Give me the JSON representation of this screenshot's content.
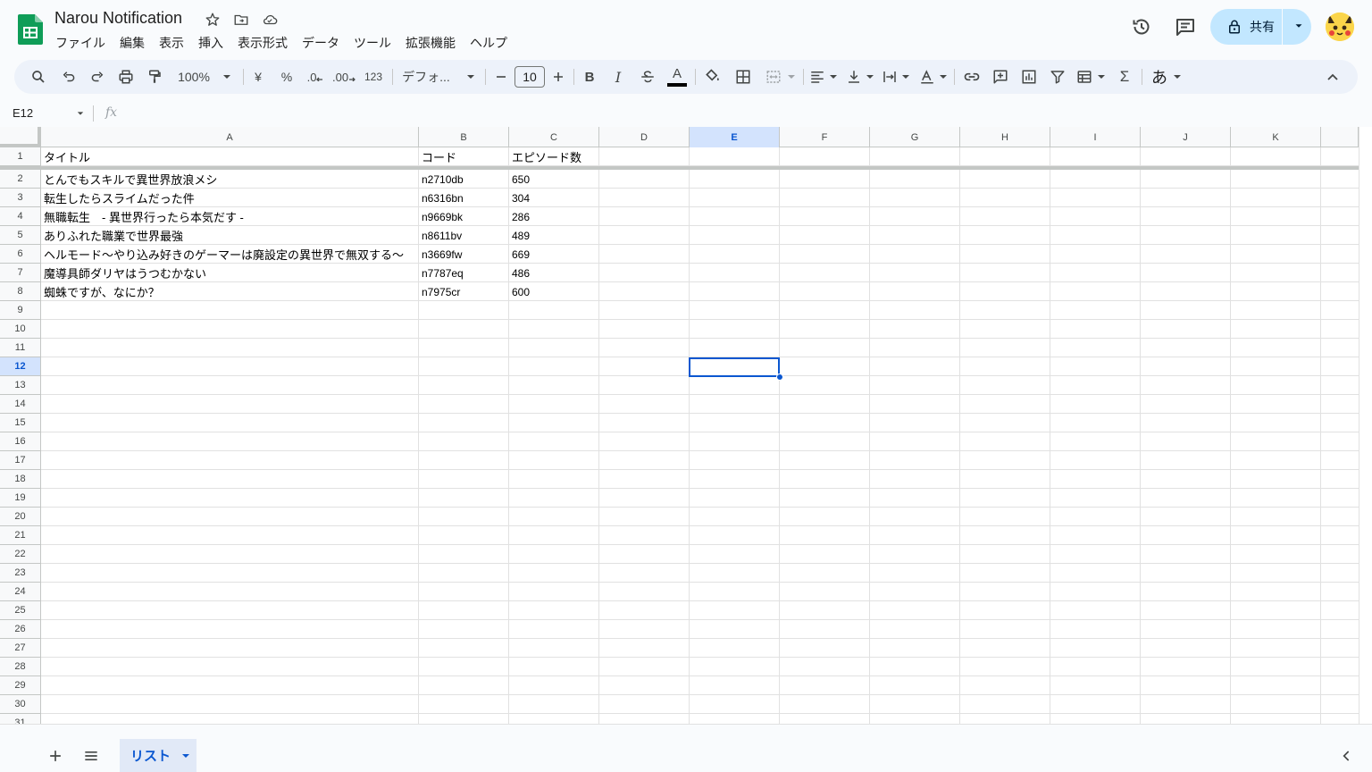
{
  "app": {
    "title": "Narou Notification",
    "menu": [
      "ファイル",
      "編集",
      "表示",
      "挿入",
      "表示形式",
      "データ",
      "ツール",
      "拡張機能",
      "ヘルプ"
    ],
    "share_label": "共有"
  },
  "toolbar": {
    "zoom": "100%",
    "currency": "¥",
    "percent": "%",
    "dec_decrease": ".0",
    "dec_increase": ".00",
    "number_format": "123",
    "font": "デフォ...",
    "font_size": "10",
    "bold": "B",
    "italic": "I",
    "text_color_letter": "A",
    "sum": "Σ",
    "input_tools": "あ",
    "accent_color": "#0b57d0"
  },
  "formula_bar": {
    "name_box": "E12",
    "fx": "fx",
    "value": ""
  },
  "grid": {
    "columns": [
      "A",
      "B",
      "C",
      "D",
      "E",
      "F",
      "G",
      "H",
      "I",
      "J",
      "K"
    ],
    "selected_column": "E",
    "selected_row": 12,
    "row_numbers": [
      "1",
      "2",
      "3",
      "4",
      "5",
      "6",
      "7",
      "8",
      "9",
      "10",
      "11",
      "12",
      "13",
      "14",
      "15",
      "16",
      "17",
      "18",
      "19",
      "20",
      "21",
      "22",
      "23",
      "24",
      "25",
      "26",
      "27",
      "28",
      "29",
      "30",
      "31"
    ],
    "header_row": [
      "タイトル",
      "コード",
      "エピソード数"
    ],
    "rows": [
      [
        "とんでもスキルで異世界放浪メシ",
        "n2710db",
        "650"
      ],
      [
        "転生したらスライムだった件",
        "n6316bn",
        "304"
      ],
      [
        "無職転生　- 異世界行ったら本気だす -",
        "n9669bk",
        "286"
      ],
      [
        "ありふれた職業で世界最強",
        "n8611bv",
        "489"
      ],
      [
        "ヘルモード～やり込み好きのゲーマーは廃設定の異世界で無双する～",
        "n3669fw",
        "669"
      ],
      [
        "魔導具師ダリヤはうつむかない",
        "n7787eq",
        "486"
      ],
      [
        "蜘蛛ですが、なにか？",
        "n7975cr",
        "600"
      ]
    ]
  },
  "sheets": [
    {
      "name": "リスト",
      "active": true
    }
  ]
}
